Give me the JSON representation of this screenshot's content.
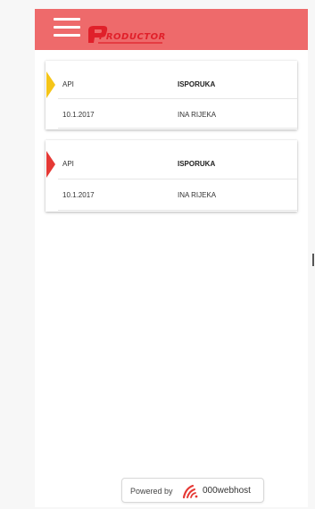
{
  "header": {
    "menu_icon": "hamburger-icon",
    "logo_text": "PRODUCTOR",
    "colors": {
      "bar": "#ee6a6b",
      "logo": "#e0202a"
    }
  },
  "cards": [
    {
      "flag_color": "#f5c518",
      "flag_icon": "flag-marker-icon",
      "row1": {
        "type": "API",
        "status": "ISPORUKA"
      },
      "row2": {
        "date": "10.1.2017",
        "location": "INA RIJEKA"
      }
    },
    {
      "flag_color": "#e53935",
      "flag_icon": "flag-marker-icon",
      "row1": {
        "type": "API",
        "status": "ISPORUKA"
      },
      "row2": {
        "date": "10.1.2017",
        "location": "INA RIJEKA"
      }
    }
  ],
  "footer_badge": {
    "powered_label": "Powered by",
    "brand": "000webhost",
    "icon": "000webhost-logo-icon"
  }
}
